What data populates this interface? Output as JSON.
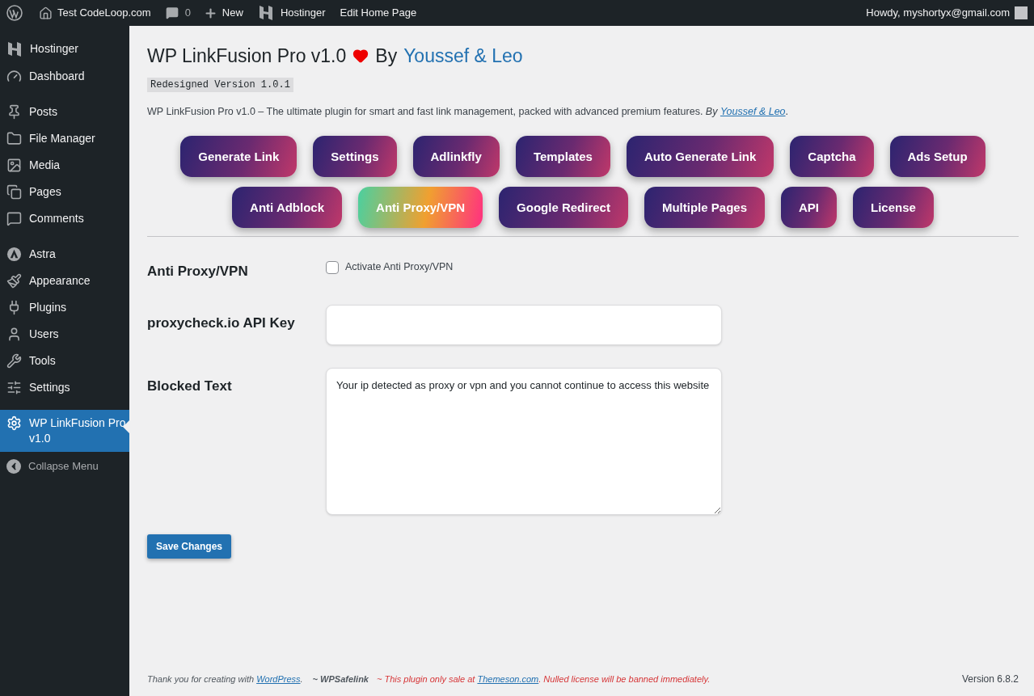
{
  "admin_bar": {
    "site": "Test CodeLoop.com",
    "comments": "0",
    "new": "New",
    "hostinger": "Hostinger",
    "edit": "Edit Home Page",
    "howdy": "Howdy, myshortyx@gmail.com"
  },
  "sidebar": {
    "groups": [
      [
        {
          "label": "Hostinger",
          "selected": false
        },
        {
          "label": "Dashboard",
          "selected": false
        }
      ],
      [
        {
          "label": "Posts",
          "selected": false
        },
        {
          "label": "File Manager",
          "selected": false
        },
        {
          "label": "Media",
          "selected": false
        },
        {
          "label": "Pages",
          "selected": false
        },
        {
          "label": "Comments",
          "selected": false
        }
      ],
      [
        {
          "label": "Astra",
          "selected": false
        },
        {
          "label": "Appearance",
          "selected": false
        },
        {
          "label": "Plugins",
          "selected": false
        },
        {
          "label": "Users",
          "selected": false
        },
        {
          "label": "Tools",
          "selected": false
        },
        {
          "label": "Settings",
          "selected": false
        }
      ],
      [
        {
          "label": "WP LinkFusion Pro v1.0",
          "selected": true
        }
      ]
    ],
    "collapse": "Collapse Menu"
  },
  "header": {
    "title": "WP LinkFusion Pro v1.0",
    "by": "By",
    "authors": "Youssef & Leo",
    "version_badge": "Redesigned Version 1.0.1",
    "description": {
      "text": "WP LinkFusion Pro v1.0 – The ultimate plugin for smart and fast link management, packed with advanced premium features. ",
      "by": "By",
      "link": "Youssef & Leo",
      "after": "."
    }
  },
  "tab_rows": [
    [
      {
        "label": "Generate Link",
        "selected": false
      },
      {
        "label": "Settings",
        "selected": false
      },
      {
        "label": "Adlinkfly",
        "selected": false
      },
      {
        "label": "Templates",
        "selected": false
      },
      {
        "label": "Auto Generate Link",
        "selected": false
      },
      {
        "label": "Captcha",
        "selected": false
      },
      {
        "label": "Ads Setup",
        "selected": false
      }
    ],
    [
      {
        "label": "Anti Adblock",
        "selected": false
      },
      {
        "label": "Anti Proxy/VPN",
        "selected": true
      },
      {
        "label": "Google Redirect",
        "selected": false
      },
      {
        "label": "Multiple Pages",
        "selected": false
      },
      {
        "label": "API",
        "selected": false
      },
      {
        "label": "License",
        "selected": false
      }
    ]
  ],
  "form": [
    {
      "kind": "checkbox",
      "label": "Anti Proxy/VPN",
      "option": "Activate Anti Proxy/VPN",
      "checked": false
    },
    {
      "kind": "input",
      "label": "proxycheck.io API Key"
    },
    {
      "kind": "textarea",
      "label": "Blocked Text",
      "value": "Your ip detected as proxy or vpn and you cannot continue to access this website"
    }
  ],
  "save_button": "Save Changes",
  "footer": {
    "thanks": {
      "text": "Thank you for creating with ",
      "link": "WordPress",
      "after": "."
    },
    "brand": "~ WPSafelink",
    "notice": {
      "text": "~ This plugin only sale at ",
      "link": "Themeson.com",
      "after": ". Nulled license will be banned immediately."
    },
    "version": "Version 6.8.2"
  }
}
